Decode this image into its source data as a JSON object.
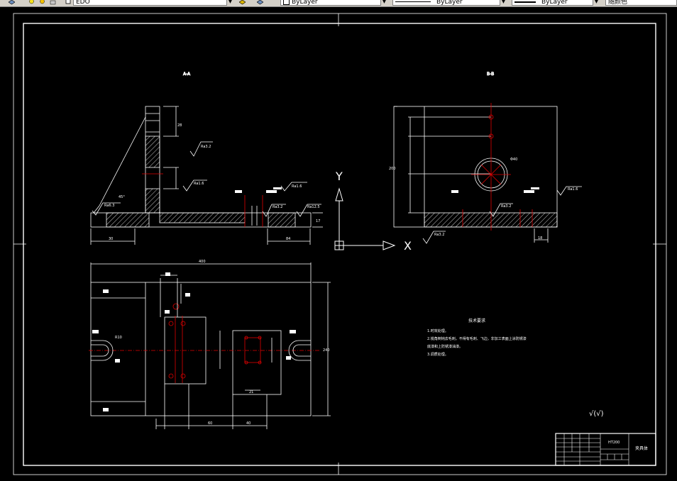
{
  "toolbar": {
    "layer_name": "EDO",
    "color_value": "ByLayer",
    "linetype_value": "ByLayer",
    "lineweight_value": "ByLayer",
    "plotstyle_value": "随颜色"
  },
  "drawing": {
    "section_a_title": "A-A",
    "section_b_title": "B-B",
    "ucs_y": "Y",
    "ucs_x": "X",
    "tech_req_title": "技术要求",
    "tech_req_lines": [
      "1.时效处理。",
      "2.锐角倒钝去毛刺，不得有毛刺、飞边，非加工表面上涂防锈漆",
      "  底漆和上防锈漆油漆。",
      "3.调质处理。"
    ],
    "roughness_note": "√(√)",
    "title_block_name": "夹具体",
    "title_block_material": "HT200",
    "dims": {
      "ra32": "Ra3.2",
      "ra16": "Ra1.6",
      "ra63": "Ra6.3",
      "ra125": "Ra12.5",
      "d30": "30",
      "d84": "84",
      "d28": "28",
      "d17": "17",
      "d400": "400",
      "d262": "262",
      "d240": "240",
      "d160": "160",
      "d100": "100",
      "d60": "60",
      "d40": "40",
      "d18": "18",
      "d50": "50",
      "d21": "21",
      "d200": "200",
      "d80": "80",
      "d10": "10",
      "d45": "45°",
      "phi8": "Φ8",
      "phi40": "Φ40",
      "r10": "R10"
    }
  }
}
